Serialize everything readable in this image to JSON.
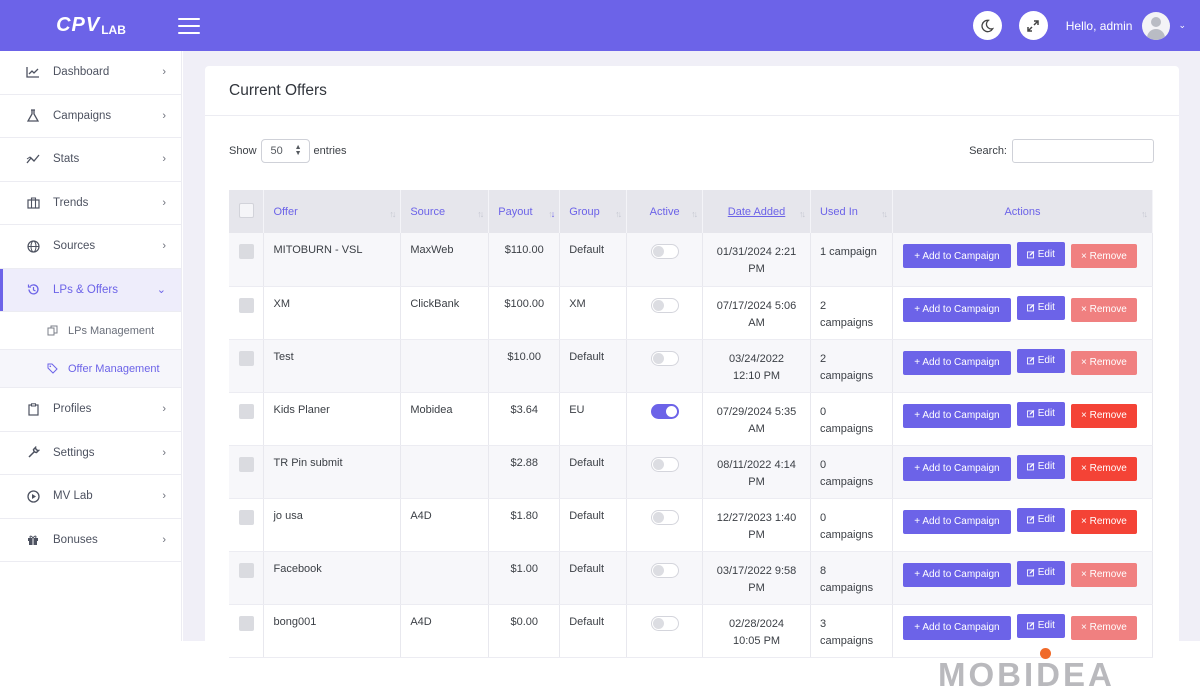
{
  "app": {
    "logo_main": "CPV",
    "logo_sub": "LAB",
    "greeting": "Hello, admin"
  },
  "sidebar": {
    "items": [
      {
        "label": "Dashboard",
        "icon": "chart-line-icon"
      },
      {
        "label": "Campaigns",
        "icon": "flask-icon"
      },
      {
        "label": "Stats",
        "icon": "stats-icon"
      },
      {
        "label": "Trends",
        "icon": "briefcase-icon"
      },
      {
        "label": "Sources",
        "icon": "globe-icon"
      },
      {
        "label": "LPs & Offers",
        "icon": "history-icon",
        "active": true
      },
      {
        "label": "Profiles",
        "icon": "clipboard-icon"
      },
      {
        "label": "Settings",
        "icon": "wrench-icon"
      },
      {
        "label": "MV Lab",
        "icon": "play-circle-icon"
      },
      {
        "label": "Bonuses",
        "icon": "gift-icon"
      }
    ],
    "subitems": [
      {
        "label": "LPs Management",
        "icon": "copy-icon"
      },
      {
        "label": "Offer Management",
        "icon": "tag-icon",
        "active": true
      }
    ]
  },
  "page": {
    "title": "Current Offers",
    "show_label": "Show",
    "entries_value": "50",
    "entries_label": "entries",
    "search_label": "Search:",
    "search_value": ""
  },
  "table": {
    "headers": [
      "Offer",
      "Source",
      "Payout",
      "Group",
      "Active",
      "Date Added",
      "Used In",
      "Actions"
    ],
    "buttons": {
      "add": "+ Add to Campaign",
      "edit": "Edit",
      "remove": "× Remove"
    },
    "rows": [
      {
        "offer": "MITOBURN - VSL",
        "source": "MaxWeb",
        "payout": "$110.00",
        "group": "Default",
        "active": false,
        "date1": "01/31/2024 2:21",
        "date2": "PM",
        "used1": "1 campaign",
        "used2": "",
        "remove_strong": false
      },
      {
        "offer": "XM",
        "source": "ClickBank",
        "payout": "$100.00",
        "group": "XM",
        "active": false,
        "date1": "07/17/2024 5:06",
        "date2": "AM",
        "used1": "2",
        "used2": "campaigns",
        "remove_strong": false
      },
      {
        "offer": "Test",
        "source": "",
        "payout": "$10.00",
        "group": "Default",
        "active": false,
        "date1": "03/24/2022",
        "date2": "12:10 PM",
        "used1": "2",
        "used2": "campaigns",
        "remove_strong": false
      },
      {
        "offer": "Kids Planer",
        "source": "Mobidea",
        "payout": "$3.64",
        "group": "EU",
        "active": true,
        "date1": "07/29/2024 5:35",
        "date2": "AM",
        "used1": "0",
        "used2": "campaigns",
        "remove_strong": true
      },
      {
        "offer": "TR Pin submit",
        "source": "",
        "payout": "$2.88",
        "group": "Default",
        "active": false,
        "date1": "08/11/2022 4:14",
        "date2": "PM",
        "used1": "0",
        "used2": "campaigns",
        "remove_strong": true
      },
      {
        "offer": "jo usa",
        "source": "A4D",
        "payout": "$1.80",
        "group": "Default",
        "active": false,
        "date1": "12/27/2023 1:40",
        "date2": "PM",
        "used1": "0",
        "used2": "campaigns",
        "remove_strong": true
      },
      {
        "offer": "Facebook",
        "source": "",
        "payout": "$1.00",
        "group": "Default",
        "active": false,
        "date1": "03/17/2022 9:58",
        "date2": "PM",
        "used1": "8",
        "used2": "campaigns",
        "remove_strong": false
      },
      {
        "offer": "bong001",
        "source": "A4D",
        "payout": "$0.00",
        "group": "Default",
        "active": false,
        "date1": "02/28/2024",
        "date2": "10:05 PM",
        "used1": "3",
        "used2": "campaigns",
        "remove_strong": false
      }
    ]
  },
  "watermark": "MOBIDEA",
  "colors": {
    "accent": "#6c63e8",
    "remove_light": "#f08080",
    "remove_strong": "#f44336",
    "watermark_dot": "#f06a2a"
  }
}
